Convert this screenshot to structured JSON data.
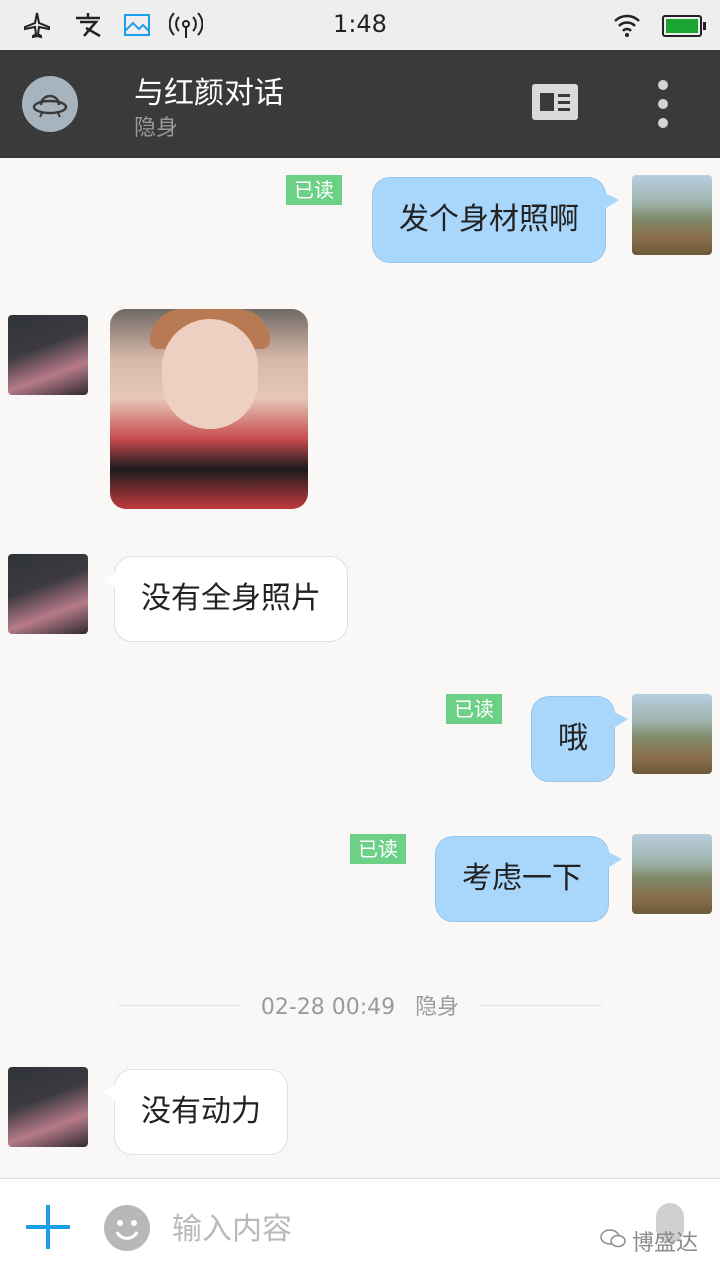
{
  "status_bar": {
    "time": "1:48",
    "icons": [
      "airplane-icon",
      "alipay-icon",
      "gallery-icon",
      "hotspot-icon",
      "wifi-icon",
      "battery-icon"
    ]
  },
  "header": {
    "title": "与红颜对话",
    "subtitle": "隐身",
    "icons": [
      "ufo-avatar-icon",
      "contact-card-icon",
      "more-vertical-icon"
    ]
  },
  "messages": [
    {
      "side": "out",
      "text": "发个身材照啊",
      "read": "已读"
    },
    {
      "side": "in",
      "type": "image"
    },
    {
      "side": "in",
      "text": "没有全身照片"
    },
    {
      "side": "out",
      "text": "哦",
      "read": "已读"
    },
    {
      "side": "out",
      "text": "考虑一下",
      "read": "已读"
    },
    {
      "side": "in",
      "text": "没有动力"
    }
  ],
  "divider": {
    "time": "02-28 00:49",
    "status": "隐身"
  },
  "input_bar": {
    "placeholder": "输入内容",
    "watermark": "博盛达"
  },
  "colors": {
    "header_bg": "#3a3a3a",
    "out_bubble": "#a9d6fb",
    "read_badge": "#6cd187",
    "accent": "#1aa0e8"
  }
}
